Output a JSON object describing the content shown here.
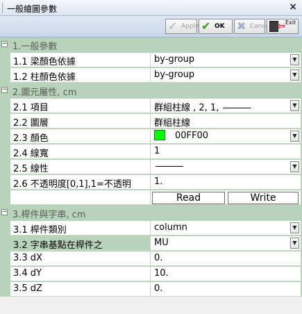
{
  "window": {
    "title": "一般繪圖參數",
    "close_glyph": "×"
  },
  "toolbar": {
    "apply_label": "Apply",
    "ok_label": "OK",
    "cancel_label": "Cancel",
    "exit_label": "Exit"
  },
  "sections": [
    {
      "title": "1.一般參數",
      "props": [
        {
          "name": "1.1 梁顏色依據",
          "value": "by-group"
        },
        {
          "name": "1.2 柱顏色依據",
          "value": "by-group"
        }
      ]
    },
    {
      "title": "2.圖元屬性, cm",
      "props": [
        {
          "name": "2.1 項目",
          "value": "群組柱線 , 2, 1,"
        },
        {
          "name": "2.2 圖層",
          "value": "群組柱線"
        },
        {
          "name": "2.3 顏色",
          "value": "00FF00",
          "color": "#00FF00"
        },
        {
          "name": "2.4 線寬",
          "value": "1"
        },
        {
          "name": "2.5 線性",
          "value": ""
        },
        {
          "name": "2.6 不透明度[0,1],1=不透明",
          "value": "1."
        }
      ],
      "read_label": "Read",
      "write_label": "Write"
    },
    {
      "title": "3.桿件與字串, cm",
      "props": [
        {
          "name": "3.1 桿件類別",
          "value": "column"
        },
        {
          "name": "3.2 字串基點在桿件之",
          "value": "MU"
        },
        {
          "name": "3.3 dX",
          "value": "0."
        },
        {
          "name": "3.4 dY",
          "value": "10."
        },
        {
          "name": "3.5 dZ",
          "value": "0."
        }
      ]
    }
  ],
  "colors": {
    "section_bg": "#b7d3ba",
    "titlebar": "#dbe4f1",
    "swatch": "#00FF00"
  },
  "icons": [
    "apply-icon",
    "ok-check-icon",
    "cancel-x-icon",
    "exit-door-icon",
    "collapse-minus-icon",
    "dropdown-arrow-icon"
  ]
}
